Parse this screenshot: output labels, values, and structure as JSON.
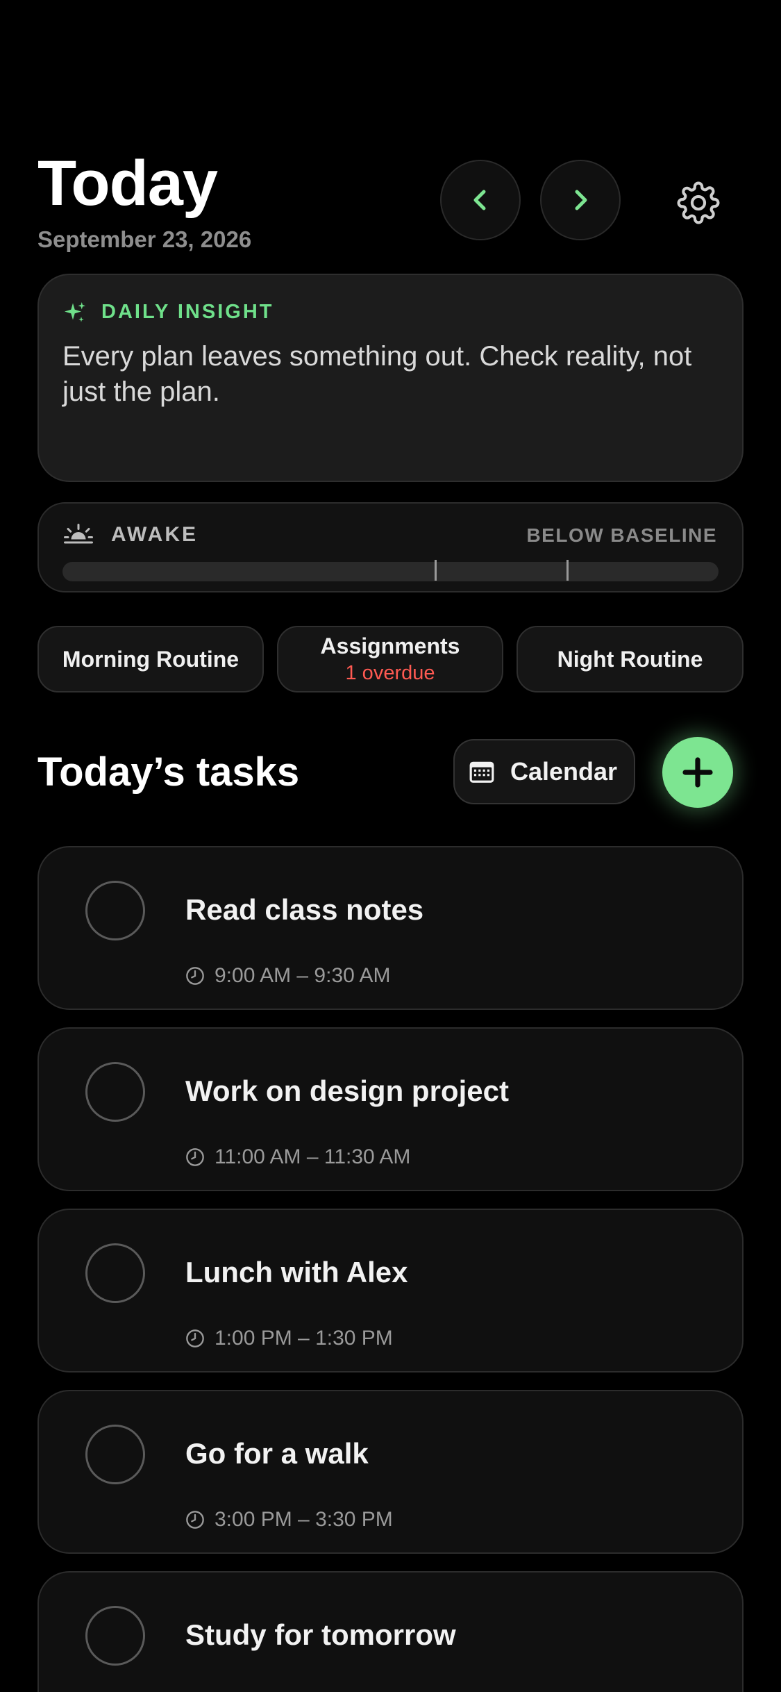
{
  "header": {
    "title": "Today",
    "date": "September 23, 2026",
    "prev_icon": "chevron-left-icon",
    "next_icon": "chevron-right-icon",
    "settings_icon": "gear-icon"
  },
  "insight": {
    "icon": "sparkle-icon",
    "label": "DAILY INSIGHT",
    "text": "Every plan leaves something out. Check reality, not just the plan."
  },
  "awake": {
    "icon": "sunrise-icon",
    "label": "AWAKE",
    "status": "BELOW BASELINE"
  },
  "chips": [
    {
      "label": "Morning Routine",
      "sub": ""
    },
    {
      "label": "Assignments",
      "sub": "1 overdue"
    },
    {
      "label": "Night Routine",
      "sub": ""
    }
  ],
  "tasks_header": {
    "title": "Today’s tasks",
    "calendar_label": "Calendar",
    "calendar_icon": "calendar-icon",
    "add_icon": "plus-icon"
  },
  "tasks": [
    {
      "name": "Read class notes",
      "time": "9:00 AM – 9:30 AM"
    },
    {
      "name": "Work on design project",
      "time": "11:00 AM – 11:30 AM"
    },
    {
      "name": "Lunch with Alex",
      "time": "1:00 PM – 1:30 PM"
    },
    {
      "name": "Go for a walk",
      "time": "3:00 PM – 3:30 PM"
    },
    {
      "name": "Study for tomorrow",
      "time": ""
    }
  ],
  "colors": {
    "accent": "#7de591",
    "overdue": "#ff5a52",
    "background": "#000000"
  }
}
